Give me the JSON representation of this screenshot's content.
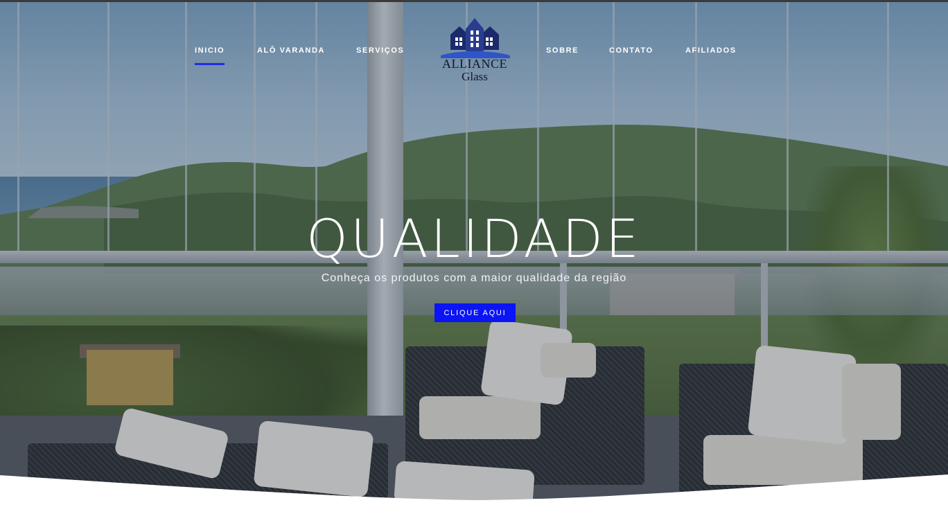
{
  "nav": {
    "items": [
      {
        "label": "INICIO",
        "active": true
      },
      {
        "label": "ALÔ VARANDA",
        "active": false
      },
      {
        "label": "SERVIÇOS",
        "active": false
      },
      {
        "label": "SOBRE",
        "active": false
      },
      {
        "label": "CONTATO",
        "active": false
      },
      {
        "label": "AFILIADOS",
        "active": false
      }
    ],
    "active_color": "#1f2fe6"
  },
  "logo": {
    "line1": "ALLIANCE",
    "line2": "Glass",
    "icon": "house-buildings-icon"
  },
  "hero": {
    "title": "QUALIDADE",
    "subtitle": "Conheça os produtos com a maior qualidade da região",
    "cta_label": "CLIQUE AQUI",
    "cta_color": "#0a14f5"
  }
}
